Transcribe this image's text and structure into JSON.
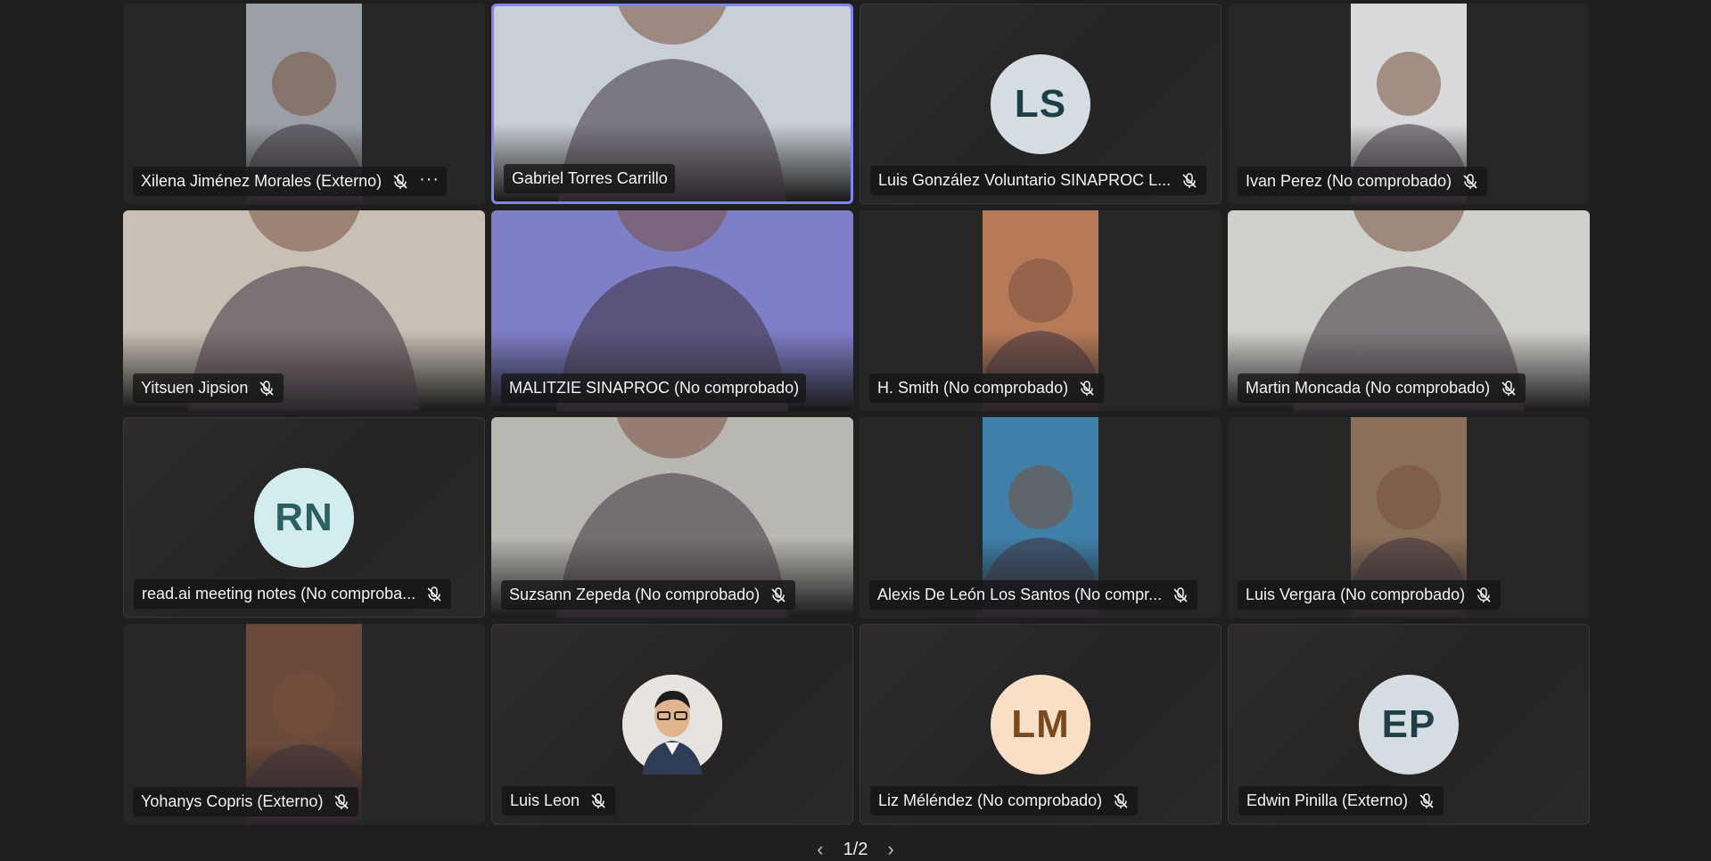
{
  "participants": [
    {
      "name": "Xilena Jiménez Morales (Externo)",
      "kind": "video-narrow",
      "bg": "#9aa0a6",
      "muted": true,
      "more": true
    },
    {
      "name": "Gabriel Torres Carrillo",
      "kind": "video-full",
      "bg": "#c9cfd6",
      "muted": false,
      "active": true
    },
    {
      "name": "Luis González Voluntario SINAPROC L...",
      "kind": "initials",
      "initials": "LS",
      "avatar_bg": "#d6dde2",
      "avatar_fg": "#1f3f47",
      "muted": true
    },
    {
      "name": "Ivan Perez (No comprobado)",
      "kind": "video-narrow",
      "bg": "#d8dadb",
      "muted": true
    },
    {
      "name": "Yitsuen Jipsion",
      "kind": "video-full",
      "bg": "#c8c0b5",
      "muted": true
    },
    {
      "name": "MALITZIE SINAPROC (No comprobado)",
      "kind": "video-full",
      "bg": "#7f7fc9",
      "muted": false
    },
    {
      "name": "H. Smith (No comprobado)",
      "kind": "video-narrow",
      "bg": "#b77a59",
      "muted": true
    },
    {
      "name": "Martin Moncada (No comprobado)",
      "kind": "video-full",
      "bg": "#cfcfcc",
      "muted": true
    },
    {
      "name": "read.ai meeting notes (No comproba...",
      "kind": "initials",
      "initials": "RN",
      "avatar_bg": "#d3ecee",
      "avatar_fg": "#2b5f62",
      "muted": true
    },
    {
      "name": "Suzsann Zepeda (No comprobado)",
      "kind": "video-full",
      "bg": "#b8b7b2",
      "muted": true
    },
    {
      "name": "Alexis De León Los Santos (No compr...",
      "kind": "video-narrow",
      "bg": "#3f7fa8",
      "muted": true
    },
    {
      "name": "Luis Vergara (No comprobado)",
      "kind": "video-narrow",
      "bg": "#8a6f5a",
      "muted": true
    },
    {
      "name": "Yohanys Copris (Externo)",
      "kind": "video-narrow",
      "bg": "#6a4a3a",
      "muted": true
    },
    {
      "name": "Luis Leon",
      "kind": "photo-avatar",
      "avatar_bg": "#e7e4e0",
      "muted": true
    },
    {
      "name": "Liz Méléndez (No comprobado)",
      "kind": "initials",
      "initials": "LM",
      "avatar_bg": "#f8dfc6",
      "avatar_fg": "#7a4a1f",
      "muted": true
    },
    {
      "name": "Edwin Pinilla (Externo)",
      "kind": "initials",
      "initials": "EP",
      "avatar_bg": "#d6dde2",
      "avatar_fg": "#1f3f47",
      "muted": true
    }
  ],
  "pager": {
    "label": "1/2"
  }
}
